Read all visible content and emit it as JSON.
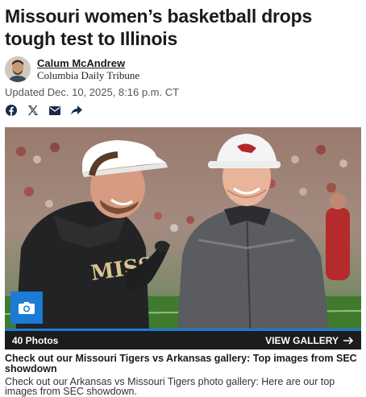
{
  "article": {
    "headline": "Missouri women’s basketball drops tough test to Illinois",
    "author_name": "Calum McAndrew",
    "outlet": "Columbia Daily Tribune",
    "updated": "Updated Dec. 10, 2025, 8:16 p.m. CT"
  },
  "share": {
    "icons": [
      "facebook-icon",
      "x-icon",
      "email-icon",
      "share-arrow-icon"
    ]
  },
  "gallery": {
    "photo_count_label": "40 Photos",
    "view_label": "VIEW GALLERY",
    "caption_title": "Check out our Missouri Tigers vs Arkansas gallery: Top images from SEC showdown",
    "caption_text": "Check out our Arkansas vs Missouri Tigers photo gallery: Here are our top images from SEC showdown.",
    "jersey_text": "MISS"
  },
  "colors": {
    "accent": "#1b7bd6",
    "gallery_bar": "#1c1c1c",
    "headline": "#1a1a1a"
  }
}
